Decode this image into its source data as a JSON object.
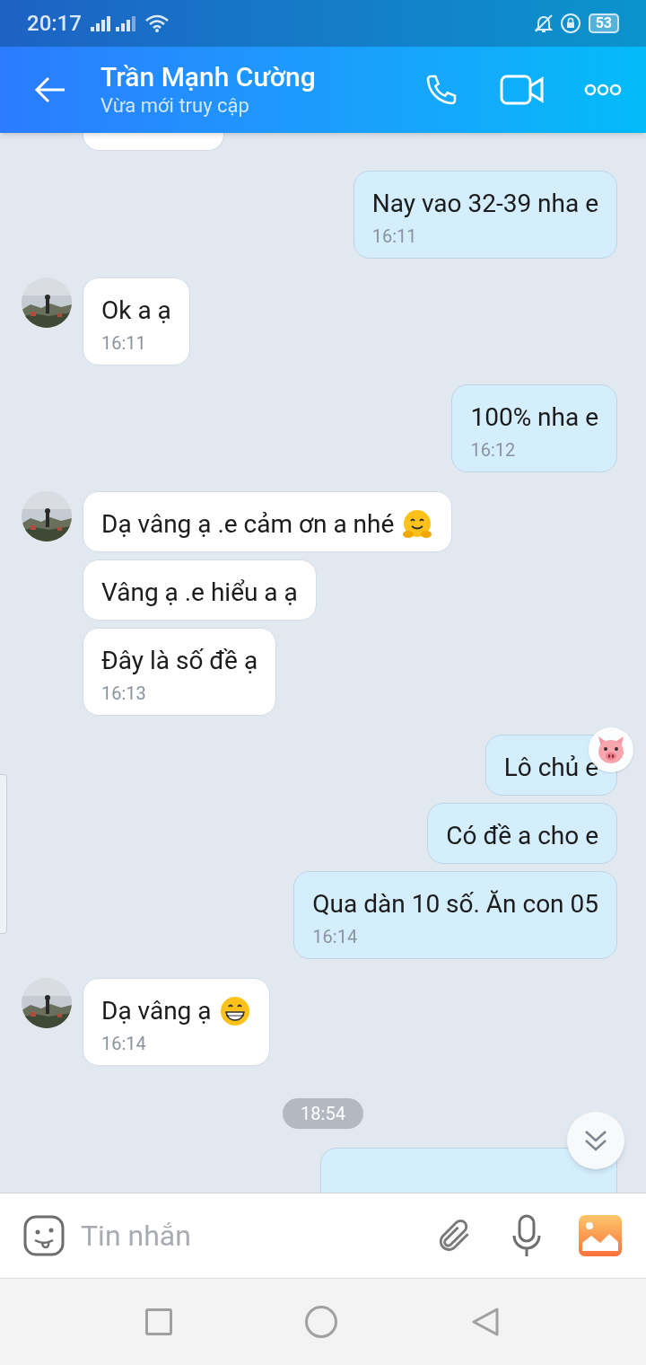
{
  "status_bar": {
    "time": "20:17",
    "battery": "53"
  },
  "header": {
    "title": "Trần Mạnh Cường",
    "subtitle": "Vừa mới truy cập"
  },
  "messages": [
    {
      "kind": "outgoing",
      "text": "Nay vao 32-39 nha e",
      "time": "16:11"
    },
    {
      "kind": "incoming",
      "avatar": true,
      "text": "Ok a ạ",
      "time": "16:11"
    },
    {
      "kind": "outgoing",
      "text": "100% nha e",
      "time": "16:12"
    },
    {
      "kind": "incoming",
      "avatar": true,
      "text": "Dạ vâng ạ .e cảm ơn a nhé",
      "emoji": {
        "kind": "hug"
      }
    },
    {
      "kind": "incoming",
      "avatar": false,
      "text": "Vâng ạ .e hiểu a ạ"
    },
    {
      "kind": "incoming",
      "avatar": false,
      "text": "Đây là số đề ạ",
      "time": "16:13"
    },
    {
      "kind": "outgoing",
      "text": "Lô chủ e",
      "reaction": {
        "kind": "pig"
      }
    },
    {
      "kind": "outgoing",
      "text": "Có đề a cho e"
    },
    {
      "kind": "outgoing",
      "text": "Qua dàn 10 số. Ăn con 05",
      "time": "16:14"
    },
    {
      "kind": "incoming",
      "avatar": true,
      "text": "Dạ vâng ạ",
      "emoji": {
        "kind": "grin"
      },
      "time": "16:14"
    },
    {
      "kind": "date",
      "text": "18:54"
    }
  ],
  "composer": {
    "placeholder": "Tin nhắn"
  }
}
